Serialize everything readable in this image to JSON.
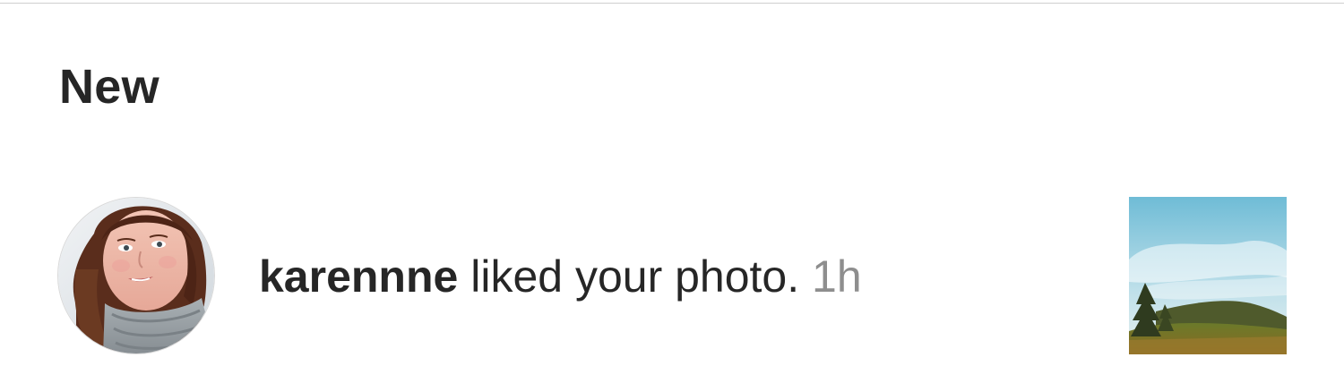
{
  "section": {
    "title": "New"
  },
  "notification": {
    "username": "karennne",
    "action": "liked your photo.",
    "timestamp": "1h",
    "avatar_icon": "profile-photo",
    "thumbnail_icon": "landscape-photo"
  },
  "colors": {
    "text_primary": "#262626",
    "text_secondary": "#8e8e8e",
    "divider": "#cfcfcf",
    "background": "#ffffff"
  }
}
